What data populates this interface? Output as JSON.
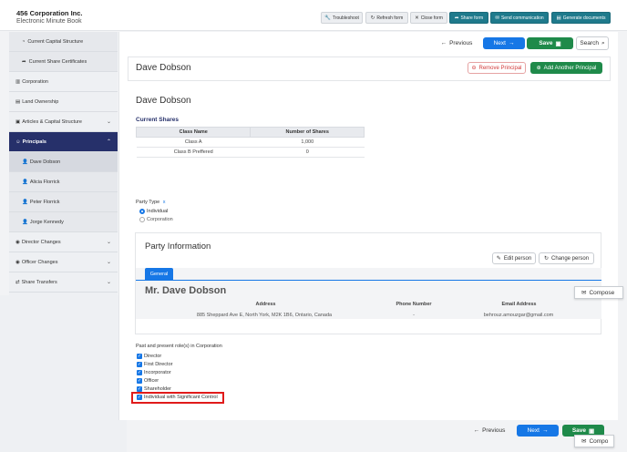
{
  "header": {
    "company_name": "456 Corporation Inc.",
    "subtitle": "Electronic Minute Book",
    "buttons": {
      "troubleshoot": "Troubleshoot",
      "refresh_form": "Refresh form",
      "close_form": "Close form",
      "share_form": "Share form",
      "send_communication": "Send communication",
      "generate_documents": "Generate documents"
    }
  },
  "sidebar": {
    "items": [
      {
        "label": "Current Capital Structure"
      },
      {
        "label": "Current Share Certificates"
      },
      {
        "label": "Corporation"
      },
      {
        "label": "Land Ownership"
      },
      {
        "label": "Articles & Capital Structure"
      },
      {
        "label": "Principals"
      },
      {
        "label": "Dave Dobson"
      },
      {
        "label": "Alicia Florrick"
      },
      {
        "label": "Peter Florrick"
      },
      {
        "label": "Jorge Kennedy"
      },
      {
        "label": "Director Changes"
      },
      {
        "label": "Officer Changes"
      },
      {
        "label": "Share Transfers"
      }
    ]
  },
  "nav": {
    "previous": "Previous",
    "next": "Next",
    "save": "Save",
    "search": "Search"
  },
  "principal": {
    "name": "Dave Dobson",
    "remove_label": "Remove Principal",
    "add_label": "Add Another Principal",
    "detail_name": "Dave Dobson",
    "current_shares_heading": "Current Shares",
    "shares_table": {
      "headers": [
        "Class Name",
        "Number of Shares"
      ],
      "rows": [
        [
          "Class A",
          "1,000"
        ],
        [
          "Class B Preffered",
          "0"
        ]
      ]
    },
    "party_type": {
      "label": "Party Type",
      "required_mark": "x",
      "options": [
        "Individual",
        "Corporation"
      ],
      "selected": "Individual"
    }
  },
  "party_info": {
    "title": "Party Information",
    "edit_person": "Edit person",
    "change_person": "Change person",
    "tab_general": "General",
    "full_name": "Mr. Dave Dobson",
    "columns": [
      "Address",
      "Phone Number",
      "Email Address"
    ],
    "address": "885 Sheppard Ave E, North York, M2K 1B6, Ontario, Canada",
    "phone": "-",
    "email": "behrouz.amouzgar@gmail.com"
  },
  "roles": {
    "heading": "Past and present role(s) in Corporation",
    "items": [
      {
        "label": "Director",
        "checked": true
      },
      {
        "label": "First Director",
        "checked": true
      },
      {
        "label": "Incorporator",
        "checked": true
      },
      {
        "label": "Officer",
        "checked": true
      },
      {
        "label": "Shareholder",
        "checked": true
      },
      {
        "label": "Individual with Significant Control",
        "checked": true
      }
    ]
  },
  "compose": {
    "label_1": "Compose",
    "label_2": "Compo"
  },
  "colors": {
    "primary_blue": "#1677e6",
    "save_green": "#1f8a4a",
    "sidebar_active": "#26306a",
    "highlight_red": "#e01b1b",
    "teal": "#1f7a8c"
  }
}
